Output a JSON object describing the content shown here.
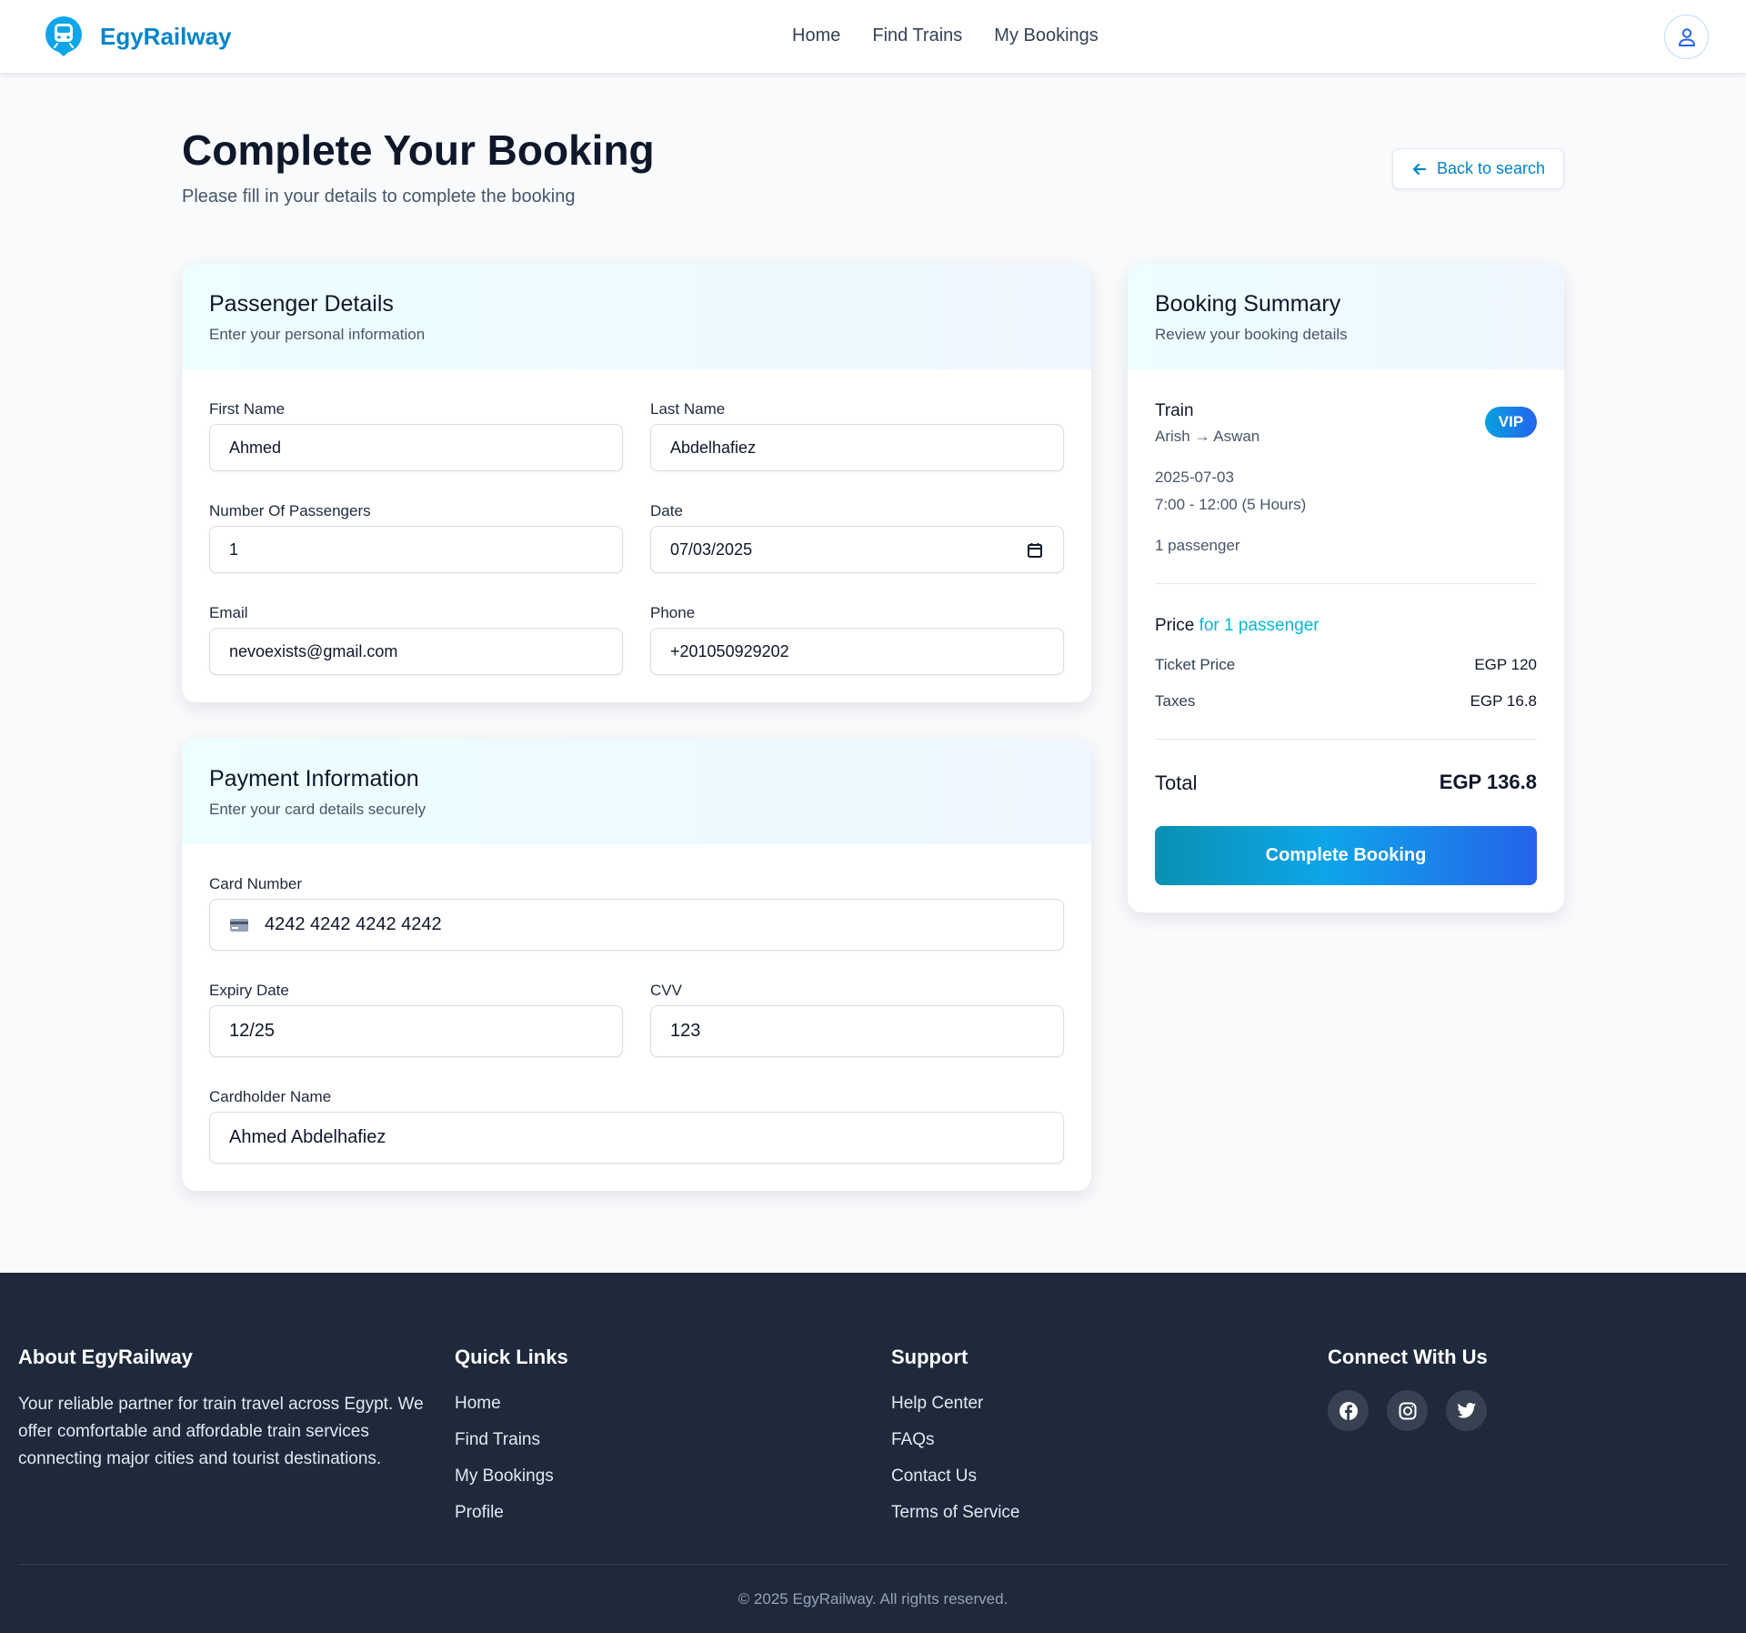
{
  "header": {
    "brand": "EgyRailway",
    "nav": [
      "Home",
      "Find Trains",
      "My Bookings"
    ]
  },
  "page": {
    "title": "Complete Your Booking",
    "subtitle": "Please fill in your details to complete the booking",
    "back_label": "Back to search"
  },
  "passenger": {
    "title": "Passenger Details",
    "subtitle": "Enter your personal information",
    "first_name_label": "First Name",
    "first_name": "Ahmed",
    "last_name_label": "Last Name",
    "last_name": "Abdelhafiez",
    "passengers_label": "Number Of Passengers",
    "passengers": "1",
    "date_label": "Date",
    "date": "07/03/2025",
    "email_label": "Email",
    "email": "nevoexists@gmail.com",
    "phone_label": "Phone",
    "phone": "+201050929202"
  },
  "payment": {
    "title": "Payment Information",
    "subtitle": "Enter your card details securely",
    "card_number_label": "Card Number",
    "card_number": "4242 4242 4242 4242",
    "expiry_label": "Expiry Date",
    "expiry": "12/25",
    "cvv_label": "CVV",
    "cvv": "123",
    "cardholder_label": "Cardholder Name",
    "cardholder": "Ahmed Abdelhafiez"
  },
  "summary": {
    "title": "Booking Summary",
    "subtitle": "Review your booking details",
    "train_label": "Train",
    "route": "Arish → Aswan",
    "class_badge": "VIP",
    "date": "2025-07-03",
    "time": "7:00 - 12:00 (5 Hours)",
    "passengers": "1 passenger",
    "price_label": "Price",
    "price_for": "for 1 passenger",
    "ticket_label": "Ticket Price",
    "ticket_value": "EGP 120",
    "taxes_label": "Taxes",
    "taxes_value": "EGP 16.8",
    "total_label": "Total",
    "total_value": "EGP 136.8",
    "button": "Complete Booking"
  },
  "footer": {
    "about_title": "About EgyRailway",
    "about_text": "Your reliable partner for train travel across Egypt. We offer comfortable and affordable train services connecting major cities and tourist destinations.",
    "links_title": "Quick Links",
    "links": [
      "Home",
      "Find Trains",
      "My Bookings",
      "Profile"
    ],
    "support_title": "Support",
    "support": [
      "Help Center",
      "FAQs",
      "Contact Us",
      "Terms of Service"
    ],
    "connect_title": "Connect With Us",
    "social_icons": [
      "facebook-icon",
      "instagram-icon",
      "twitter-icon"
    ],
    "copyright": "© 2025 EgyRailway. All rights reserved."
  },
  "colors": {
    "brand": "#0284c7",
    "accent_cyan": "#06b6d4",
    "footer_bg": "#1e293b"
  }
}
